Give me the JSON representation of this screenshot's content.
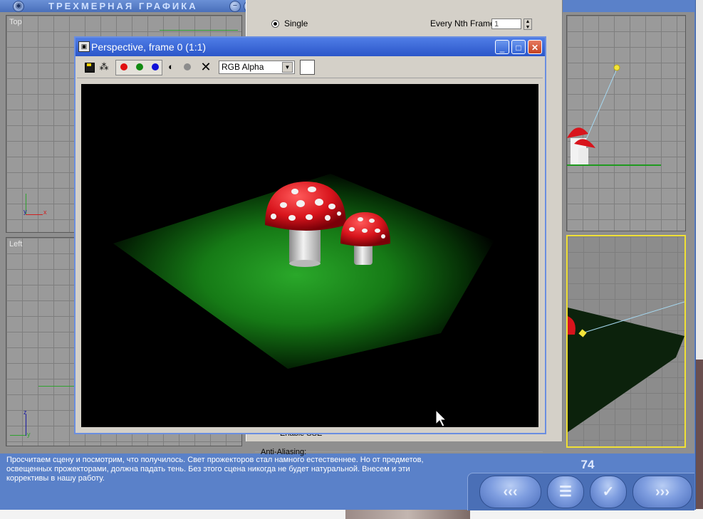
{
  "app": {
    "title": "ТРЕХМЕРНАЯ ГРАФИКА",
    "minimize_glyph": "−",
    "close_glyph": "×",
    "icon_glyph": "◉"
  },
  "viewports": {
    "top_label": "Top",
    "left_label": "Left",
    "top_axes": {
      "x": "x",
      "y": "y"
    },
    "left_axes": {
      "y": "z",
      "x": "y"
    }
  },
  "render_dialog": {
    "single_label": "Single",
    "every_nth_label": "Every Nth Frame:",
    "every_nth_value": "1",
    "enable_label": "Enable SSE",
    "anti_aliasing_label": "Anti-Aliasing:"
  },
  "frame_window": {
    "title": "Perspective, frame 0 (1:1)",
    "icon_glyph": "▣",
    "min_glyph": "_",
    "max_glyph": "□",
    "close_glyph": "✕",
    "clone_glyph": "⁂",
    "mono_glyph": "◐",
    "clear_glyph": "✕",
    "channel_value": "RGB Alpha",
    "dropdown_glyph": "▼",
    "swatch_color": "#ffffff"
  },
  "colors": {
    "window_blue": "#5a81c9",
    "title_blue": "#2b56c9",
    "mushroom_red": "#d8141c",
    "ground_green": "#1f9a1f"
  },
  "narration": {
    "text": "Просчитаем сцену и посмотрим, что получилось. Свет прожекторов стал намного естественнее. Но от предметов, освещенных прожекторами, должна падать тень. Без этого сцена никогда не будет натуральной. Внесем и эти коррективы в нашу работу."
  },
  "page_number": "74",
  "nav": {
    "back_glyph": "‹‹‹",
    "menu_glyph": "☰",
    "check_glyph": "✓",
    "forward_glyph": "›››"
  }
}
